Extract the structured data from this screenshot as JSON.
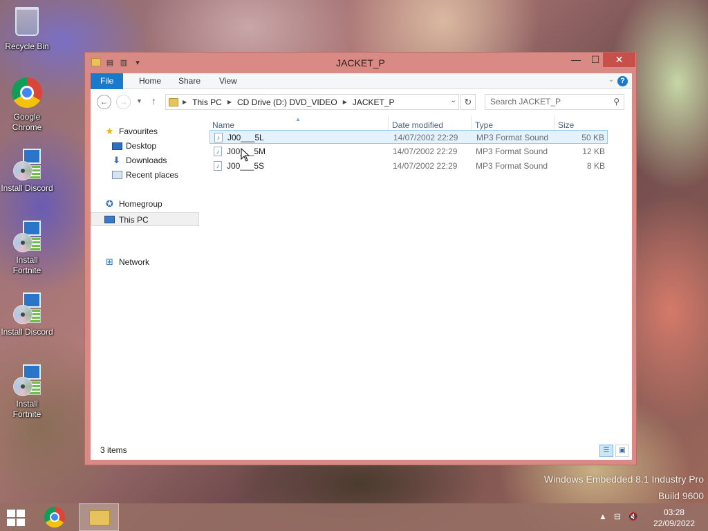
{
  "desktop": {
    "icons": [
      {
        "label": "Recycle Bin"
      },
      {
        "label": "Google Chrome"
      },
      {
        "label": "Install Discord"
      },
      {
        "label": "Install Fortnite"
      },
      {
        "label": "Install Discord"
      },
      {
        "label": "Install Fortnite"
      }
    ]
  },
  "window": {
    "title": "JACKET_P",
    "minimize_symbol": "—",
    "maximize_symbol": "☐",
    "close_symbol": "✕",
    "ribbon_tabs": [
      "File",
      "Home",
      "Share",
      "View"
    ],
    "help_symbol": "?",
    "address": {
      "crumbs": [
        "This PC",
        "CD Drive (D:) DVD_VIDEO",
        "JACKET_P"
      ]
    },
    "search": {
      "placeholder": "Search JACKET_P"
    },
    "nav_pane": {
      "favourites": "Favourites",
      "desktop": "Desktop",
      "downloads": "Downloads",
      "recent": "Recent places",
      "homegroup": "Homegroup",
      "this_pc": "This PC",
      "network": "Network"
    },
    "columns": {
      "name": "Name",
      "date": "Date modified",
      "type": "Type",
      "size": "Size"
    },
    "files": [
      {
        "name": "J00___5L",
        "date": "14/07/2002 22:29",
        "type": "MP3 Format Sound",
        "size": "50 KB"
      },
      {
        "name": "J00___5M",
        "date": "14/07/2002 22:29",
        "type": "MP3 Format Sound",
        "size": "12 KB"
      },
      {
        "name": "J00___5S",
        "date": "14/07/2002 22:29",
        "type": "MP3 Format Sound",
        "size": "8 KB"
      }
    ],
    "status": {
      "item_count": "3 items"
    }
  },
  "watermark": {
    "line1": "Windows Embedded 8.1 Industry Pro",
    "line2": "Build 9600"
  },
  "taskbar": {
    "time": "03:28",
    "date": "22/09/2022"
  },
  "colors": {
    "accent": "#1979ca",
    "window_frame": "#d98a84",
    "close_button": "#c7504a",
    "selection": "#e5f1fb"
  },
  "icons": {
    "back": "arrow-left-icon",
    "forward": "arrow-right-icon",
    "up": "arrow-up-icon",
    "refresh": "refresh-icon",
    "search": "search-icon"
  }
}
